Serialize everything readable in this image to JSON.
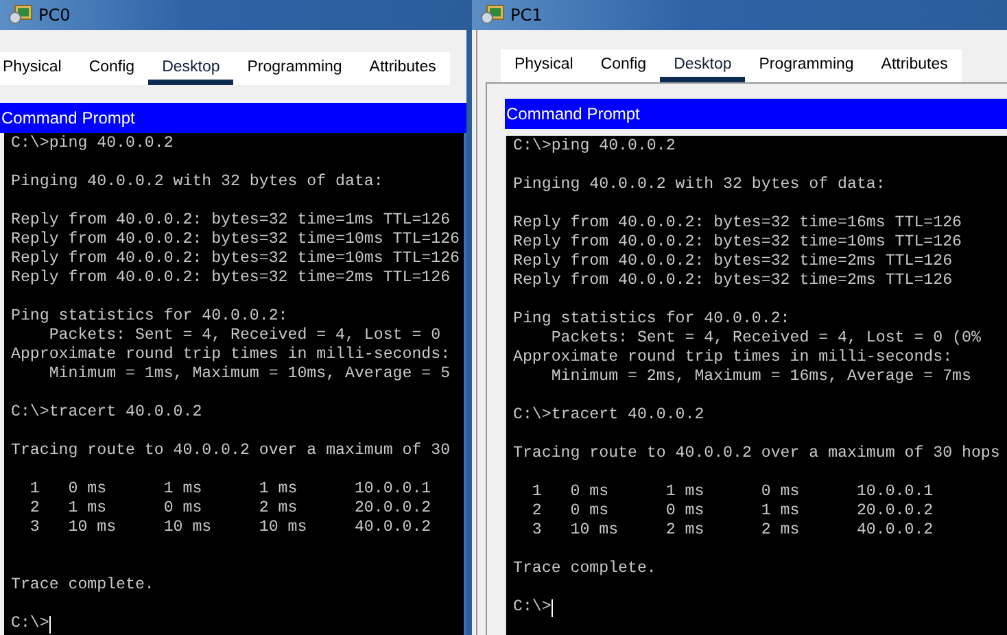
{
  "windows": [
    {
      "title": "PC0",
      "tabs": [
        {
          "label": "Physical",
          "selected": false
        },
        {
          "label": "Config",
          "selected": false
        },
        {
          "label": "Desktop",
          "selected": true
        },
        {
          "label": "Programming",
          "selected": false
        },
        {
          "label": "Attributes",
          "selected": false
        }
      ],
      "console_title": "Command Prompt",
      "console": [
        {
          "kind": "text",
          "text": "C:\\>ping 40.0.0.2"
        },
        {
          "kind": "blank"
        },
        {
          "kind": "text",
          "text": "Pinging 40.0.0.2 with 32 bytes of data:"
        },
        {
          "kind": "blank"
        },
        {
          "kind": "text",
          "text": "Reply from 40.0.0.2: bytes=32 time=1ms TTL=126"
        },
        {
          "kind": "text",
          "text": "Reply from 40.0.0.2: bytes=32 time=10ms TTL=126"
        },
        {
          "kind": "text",
          "text": "Reply from 40.0.0.2: bytes=32 time=10ms TTL=126"
        },
        {
          "kind": "text",
          "text": "Reply from 40.0.0.2: bytes=32 time=2ms TTL=126"
        },
        {
          "kind": "blank"
        },
        {
          "kind": "text",
          "text": "Ping statistics for 40.0.0.2:"
        },
        {
          "kind": "text",
          "text": "    Packets: Sent = 4, Received = 4, Lost = 0"
        },
        {
          "kind": "text",
          "text": "Approximate round trip times in milli-seconds:"
        },
        {
          "kind": "text",
          "text": "    Minimum = 1ms, Maximum = 10ms, Average = 5"
        },
        {
          "kind": "blank"
        },
        {
          "kind": "text",
          "text": "C:\\>tracert 40.0.0.2"
        },
        {
          "kind": "blank"
        },
        {
          "kind": "text",
          "text": "Tracing route to 40.0.0.2 over a maximum of 30"
        },
        {
          "kind": "blank"
        },
        {
          "kind": "text",
          "text": "  1   0 ms      1 ms      1 ms      10.0.0.1"
        },
        {
          "kind": "text",
          "text": "  2   1 ms      0 ms      2 ms      20.0.0.2"
        },
        {
          "kind": "text",
          "text": "  3   10 ms     10 ms     10 ms     40.0.0.2"
        },
        {
          "kind": "blank"
        },
        {
          "kind": "blank"
        },
        {
          "kind": "text",
          "text": "Trace complete."
        },
        {
          "kind": "blank"
        },
        {
          "kind": "prompt",
          "text": "C:\\>"
        }
      ]
    },
    {
      "title": "PC1",
      "tabs": [
        {
          "label": "Physical",
          "selected": false
        },
        {
          "label": "Config",
          "selected": false
        },
        {
          "label": "Desktop",
          "selected": true
        },
        {
          "label": "Programming",
          "selected": false
        },
        {
          "label": "Attributes",
          "selected": false
        }
      ],
      "console_title": "Command Prompt",
      "console": [
        {
          "kind": "text",
          "text": "C:\\>ping 40.0.0.2"
        },
        {
          "kind": "blank"
        },
        {
          "kind": "text",
          "text": "Pinging 40.0.0.2 with 32 bytes of data:"
        },
        {
          "kind": "blank"
        },
        {
          "kind": "text",
          "text": "Reply from 40.0.0.2: bytes=32 time=16ms TTL=126"
        },
        {
          "kind": "text",
          "text": "Reply from 40.0.0.2: bytes=32 time=10ms TTL=126"
        },
        {
          "kind": "text",
          "text": "Reply from 40.0.0.2: bytes=32 time=2ms TTL=126"
        },
        {
          "kind": "text",
          "text": "Reply from 40.0.0.2: bytes=32 time=2ms TTL=126"
        },
        {
          "kind": "blank"
        },
        {
          "kind": "text",
          "text": "Ping statistics for 40.0.0.2:"
        },
        {
          "kind": "text",
          "text": "    Packets: Sent = 4, Received = 4, Lost = 0 (0%"
        },
        {
          "kind": "text",
          "text": "Approximate round trip times in milli-seconds:"
        },
        {
          "kind": "text",
          "text": "    Minimum = 2ms, Maximum = 16ms, Average = 7ms"
        },
        {
          "kind": "blank"
        },
        {
          "kind": "text",
          "text": "C:\\>tracert 40.0.0.2"
        },
        {
          "kind": "blank"
        },
        {
          "kind": "text",
          "text": "Tracing route to 40.0.0.2 over a maximum of 30 hops"
        },
        {
          "kind": "blank"
        },
        {
          "kind": "text",
          "text": "  1   0 ms      1 ms      0 ms      10.0.0.1"
        },
        {
          "kind": "text",
          "text": "  2   0 ms      0 ms      1 ms      20.0.0.2"
        },
        {
          "kind": "text",
          "text": "  3   10 ms     2 ms      2 ms      40.0.0.2"
        },
        {
          "kind": "blank"
        },
        {
          "kind": "text",
          "text": "Trace complete."
        },
        {
          "kind": "blank"
        },
        {
          "kind": "prompt",
          "text": "C:\\>"
        }
      ]
    }
  ]
}
